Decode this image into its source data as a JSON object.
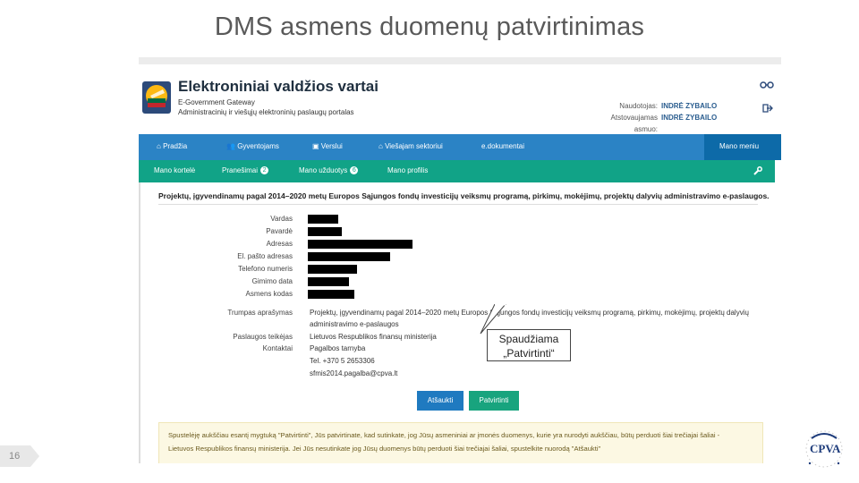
{
  "slide": {
    "title": "DMS asmens duomenų patvirtinimas",
    "page_number": "16"
  },
  "header": {
    "brand": "Elektroniniai valdžios vartai",
    "sub1": "E-Government Gateway",
    "sub2": "Administracinių ir viešųjų elektroninių paslaugų portalas",
    "user_label": "Naudotojas:",
    "user_value": "INDRĖ ZYBAILO",
    "rep_label": "Atstovaujamas asmuo:",
    "rep_value": "INDRĖ ZYBAILO"
  },
  "nav_main": [
    {
      "label": "Pradžia",
      "icon": "home-icon"
    },
    {
      "label": "Gyventojams",
      "icon": "people-icon"
    },
    {
      "label": "Verslui",
      "icon": "briefcase-icon"
    },
    {
      "label": "Viešajam sektoriui",
      "icon": "building-icon"
    },
    {
      "label": "e.dokumentai"
    },
    {
      "label": "Mano meniu"
    }
  ],
  "nav_sub": [
    {
      "label": "Mano kortelė"
    },
    {
      "label": "Pranešimai",
      "badge": "2"
    },
    {
      "label": "Mano užduotys",
      "badge": "6"
    },
    {
      "label": "Mano profilis"
    }
  ],
  "panel": {
    "title": "Projektų, įgyvendinamų pagal 2014–2020 metų Europos Sąjungos fondų investicijų veiksmų programą, pirkimų, mokėjimų, projektų dalyvių administravimo e-paslaugos.",
    "fields": [
      {
        "label": "Vardas"
      },
      {
        "label": "Pavardė"
      },
      {
        "label": "Adresas"
      },
      {
        "label": "El. pašto adresas"
      },
      {
        "label": "Telefono numeris"
      },
      {
        "label": "Gimimo data"
      },
      {
        "label": "Asmens kodas"
      }
    ],
    "scope_label": "Trumpas aprašymas",
    "scope_line1": "Projektų, įgyvendinamų pagal 2014–2020 metų Europos Sąjungos fondų investicijų veiksmų programą, pirkimų, mokėjimų, projektų dalyvių",
    "scope_line2": "administravimo e-paslaugos",
    "provider_label": "Paslaugos teikėjas",
    "provider_value": "Lietuvos Respublikos finansų ministerija",
    "contacts_label": "Kontaktai",
    "contact1": "Pagalbos tarnyba",
    "contact2": "Tel. +370 5 2653306",
    "contact3": "sfmis2014.pagalba@cpva.lt",
    "cancel_label": "Atšaukti",
    "confirm_label": "Patvirtinti",
    "callout_line1": "Spaudžiama",
    "callout_line2": "„Patvirtinti“",
    "notice_line1": "Spustelėję aukščiau esantį mygtuką \"Patvirtinti\", Jūs patvirtinate, kad sutinkate, jog Jūsų asmeniniai ar įmonės duomenys, kurie yra nurodyti aukščiau, būtų perduoti šiai trečiajai šaliai -",
    "notice_line2": "Lietuvos Respublikos finansų ministerija. Jei Jūs nesutinkate jog Jūsų duomenys būtų perduoti šiai trečiajai šaliai, spustelkite nuorodą \"Atšaukti\""
  },
  "logo": {
    "text": "CPVA"
  },
  "colors": {
    "nav_blue": "#2b83c5",
    "nav_green": "#11a387",
    "cancel_blue": "#1f7ac0",
    "confirm_green": "#18a47e"
  }
}
